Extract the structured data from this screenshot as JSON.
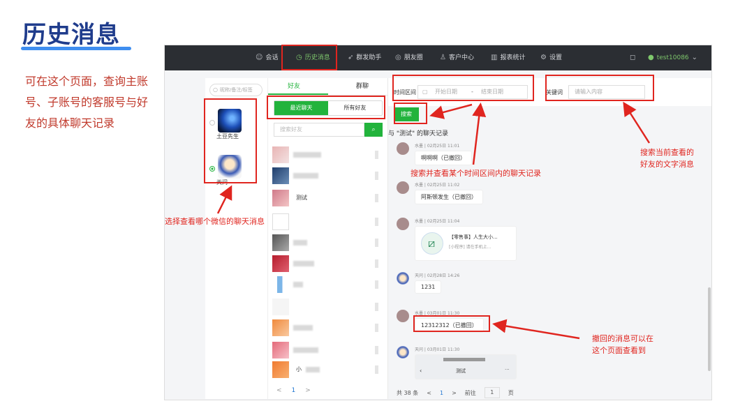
{
  "slide": {
    "title": "历史消息",
    "intro": "可在这个页面，查询主账号、子账号的客服号与好友的具体聊天记录"
  },
  "topbar": {
    "items": [
      {
        "icon": "chat-icon",
        "glyph": "☺",
        "label": "会话"
      },
      {
        "icon": "clock-icon",
        "glyph": "◷",
        "label": "历史消息"
      },
      {
        "icon": "send-icon",
        "glyph": "➶",
        "label": "群发助手"
      },
      {
        "icon": "moments-icon",
        "glyph": "◎",
        "label": "朋友圈"
      },
      {
        "icon": "user-icon",
        "glyph": "♙",
        "label": "客户中心"
      },
      {
        "icon": "bar-chart-icon",
        "glyph": "▥",
        "label": "报表统计"
      },
      {
        "icon": "gear-icon",
        "glyph": "⚙",
        "label": "设置"
      }
    ],
    "active_index": 1,
    "bell_glyph": "🔔",
    "user": "test10086"
  },
  "accounts": {
    "search_placeholder": "昵称/备注/标签",
    "items": [
      {
        "name": "土豆先生",
        "selected": false
      },
      {
        "name": "天问",
        "selected": true
      }
    ]
  },
  "friends": {
    "tab_friends": "好友",
    "tab_groups": "群聊",
    "seg_recent": "最近聊天",
    "seg_all": "所有好友",
    "search_placeholder": "搜索好友",
    "named_friend": "测试",
    "partial_friend": "小",
    "pager": {
      "prev": "<",
      "page": "1",
      "next": ">"
    }
  },
  "chat": {
    "time_label": "时间区间",
    "start_placeholder": "开始日期",
    "end_placeholder": "结束日期",
    "keyword_label": "关键词",
    "keyword_placeholder": "请输入内容",
    "search_button": "搜索",
    "title": "与 \"测试\" 的聊天记录",
    "messages": [
      {
        "meta": "水墨 | 02月25日 11:01",
        "text": "啊啊啊（已撤回）"
      },
      {
        "meta": "水墨 | 02月25日 11:02",
        "text": "阿斯顿发生（已撤回）"
      },
      {
        "meta": "水墨 | 02月25日 11:04",
        "card_title": "【零售事】人生大小...",
        "card_sub": "[小程序] 请在手机上..."
      },
      {
        "meta": "天问 | 02月28日 14:26",
        "text": "1231"
      },
      {
        "meta": "水墨 | 03月01日 11:30",
        "text": "12312312（已撤回）"
      },
      {
        "meta": "天问 | 03月01日 11:30",
        "card_label": "测试"
      }
    ],
    "pager": {
      "total": "共 38 条",
      "prev": "<",
      "page": "1",
      "next": ">",
      "goto": "前往",
      "goto_value": "1",
      "unit": "页"
    }
  },
  "annotations": {
    "select_account": "选择查看哪个微信的聊天消息",
    "search_range": "搜索并查看某个时间区间内的聊天记录",
    "search_keyword_1": "搜索当前查看的",
    "search_keyword_2": "好友的文字消息",
    "recalled_1": "撤回的消息可以在",
    "recalled_2": "这个页面查看到"
  },
  "colors": {
    "accent": "#22b33c",
    "annotation": "#e0251f",
    "title": "#1f3c8c"
  }
}
